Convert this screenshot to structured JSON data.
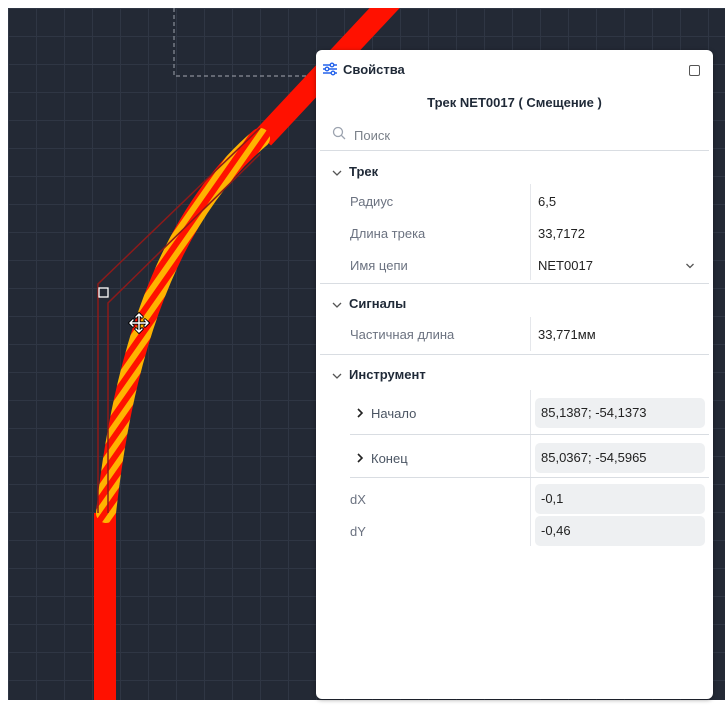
{
  "panel": {
    "title": "Свойства",
    "subtitle": "Трек NET0017 ( Смещение )",
    "search": {
      "placeholder": "Поиск"
    },
    "sections": {
      "track": {
        "title": "Трек",
        "rows": [
          {
            "label": "Радиус",
            "value": "6,5"
          },
          {
            "label": "Длина трека",
            "value": "33,7172"
          },
          {
            "label": "Имя цепи",
            "value": "NET0017"
          }
        ]
      },
      "signals": {
        "title": "Сигналы",
        "rows": [
          {
            "label": "Частичная длина",
            "value": "33,771мм"
          }
        ]
      },
      "tool": {
        "title": "Инструмент",
        "start": {
          "label": "Начало",
          "value": "85,1387; -54,1373"
        },
        "end": {
          "label": "Конец",
          "value": "85,0367; -54,5965"
        },
        "dx": {
          "label": "dX",
          "value": "-0,1"
        },
        "dy": {
          "label": "dY",
          "value": "-0,46"
        }
      }
    }
  },
  "colors": {
    "canvas_bg": "#232935",
    "grid": "#2f3644",
    "track": "#ff1100",
    "highlight_stripe": "#ffb300",
    "outline": "#8b1a1a"
  },
  "icons": {
    "panel": "sliders-icon",
    "maximize": "maximize-icon",
    "search": "search-icon",
    "cursor": "move-cursor-icon"
  }
}
